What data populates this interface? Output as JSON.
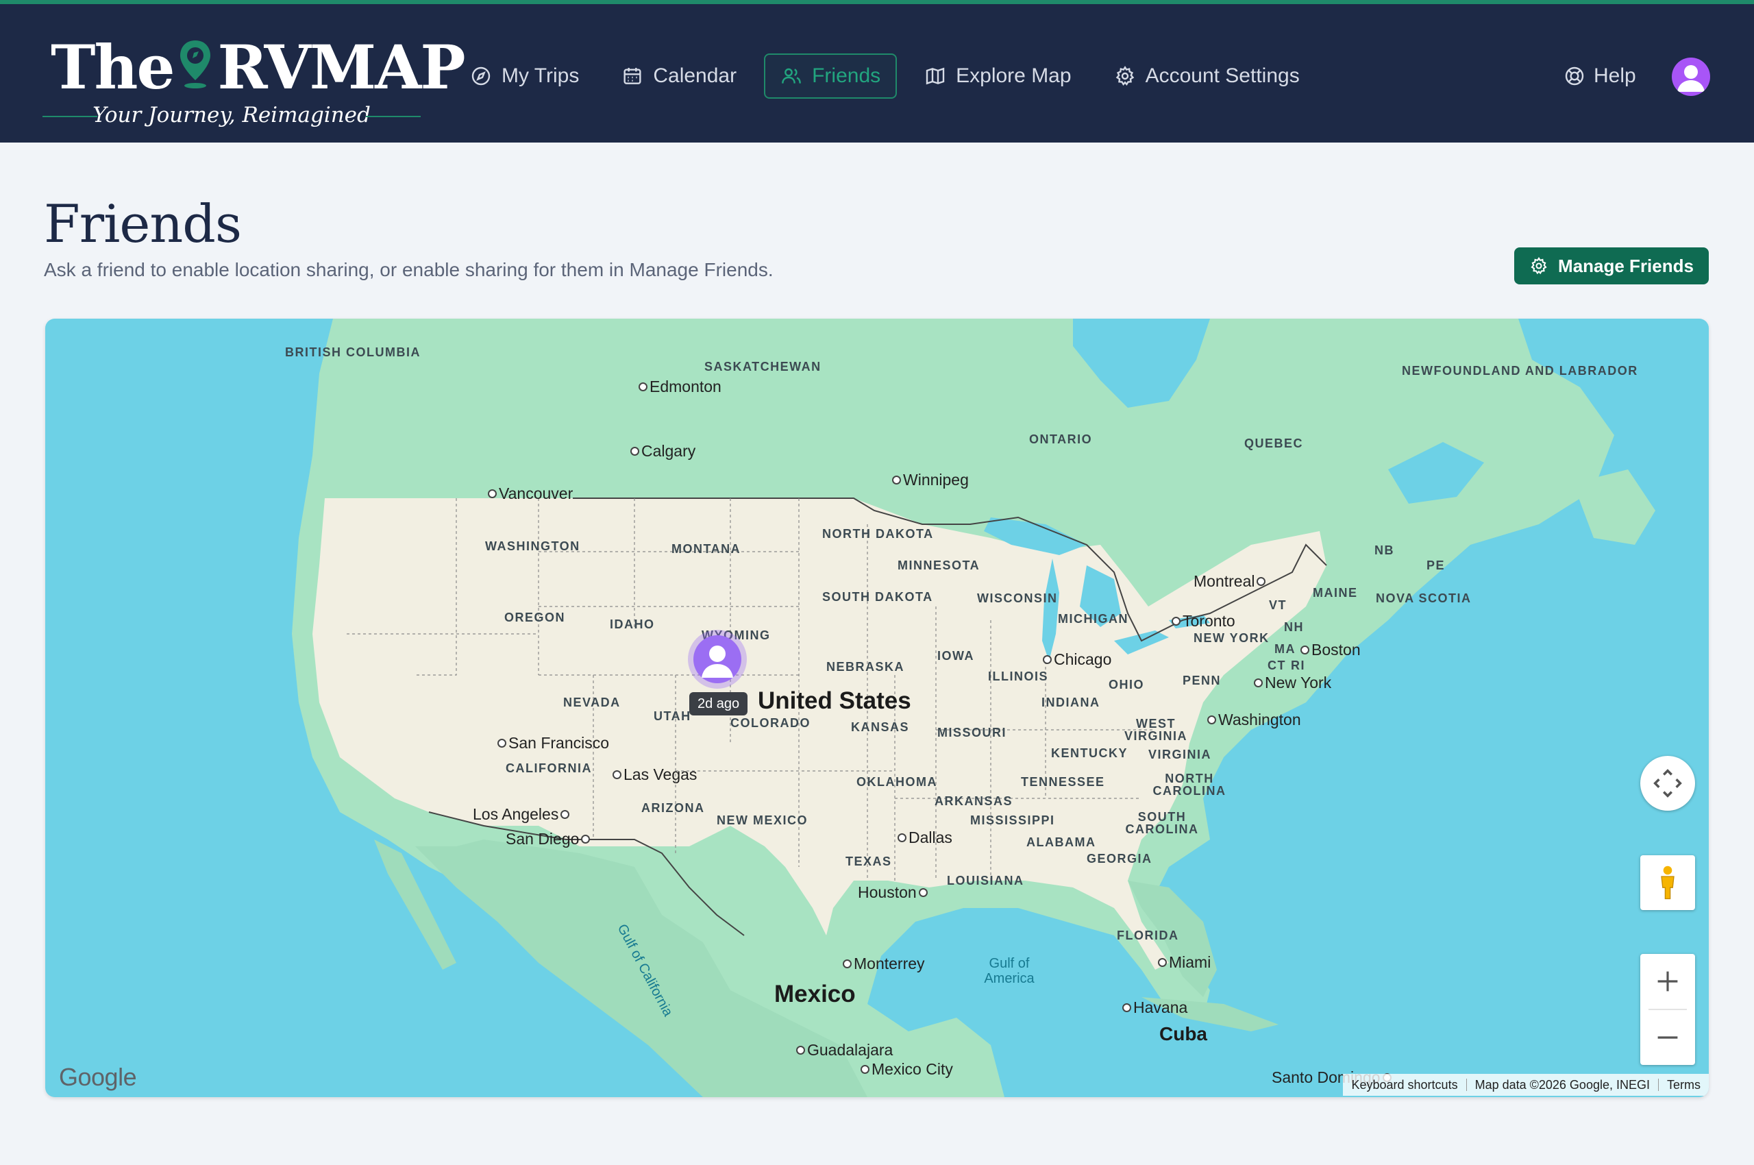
{
  "brand": {
    "title_left": "The",
    "title_right": "RVMAP",
    "tagline": "Your Journey, Reimagined"
  },
  "nav": {
    "items": [
      {
        "label": "My Trips",
        "icon": "compass-icon",
        "active": false
      },
      {
        "label": "Calendar",
        "icon": "calendar-icon",
        "active": false
      },
      {
        "label": "Friends",
        "icon": "users-icon",
        "active": true
      },
      {
        "label": "Explore Map",
        "icon": "map-icon",
        "active": false
      },
      {
        "label": "Account Settings",
        "icon": "gear-icon",
        "active": false
      }
    ],
    "help_label": "Help"
  },
  "colors": {
    "header_bg": "#1d2946",
    "accent": "#1f8a6a",
    "button_bg": "#0f6b52",
    "avatar": "#a855f7",
    "water": "#6dd1e6",
    "land": "#a8e3c2",
    "us_land": "#f2efe2"
  },
  "page": {
    "title": "Friends",
    "subtitle": "Ask a friend to enable location sharing, or enable sharing for them in Manage Friends.",
    "manage_button": "Manage Friends"
  },
  "map": {
    "friend_marker": {
      "last_seen": "2d ago"
    },
    "countries": [
      "United States",
      "Mexico",
      "Cuba"
    ],
    "regions": [
      "BRITISH COLUMBIA",
      "SASKATCHEWAN",
      "ONTARIO",
      "QUEBEC",
      "NEWFOUNDLAND AND LABRADOR",
      "NORTH DAKOTA",
      "SOUTH DAKOTA",
      "WASHINGTON",
      "MONTANA",
      "OREGON",
      "IDAHO",
      "WYOMING",
      "NEVADA",
      "UTAH",
      "COLORADO",
      "CALIFORNIA",
      "ARIZONA",
      "NEW MEXICO",
      "NEBRASKA",
      "KANSAS",
      "OKLAHOMA",
      "TEXAS",
      "MINNESOTA",
      "IOWA",
      "MISSOURI",
      "ARKANSAS",
      "LOUISIANA",
      "WISCONSIN",
      "ILLINOIS",
      "MICHIGAN",
      "INDIANA",
      "OHIO",
      "KENTUCKY",
      "TENNESSEE",
      "MISSISSIPPI",
      "ALABAMA",
      "GEORGIA",
      "FLORIDA",
      "SOUTH CAROLINA",
      "NORTH CAROLINA",
      "VIRGINIA",
      "WEST VIRGINIA",
      "PENN",
      "NEW YORK",
      "VT",
      "NH",
      "MAINE",
      "MA",
      "CT",
      "RI",
      "NB",
      "PE",
      "NOVA SCOTIA"
    ],
    "cities": [
      "Edmonton",
      "Calgary",
      "Vancouver",
      "Winnipeg",
      "Montreal",
      "Toronto",
      "Boston",
      "New York",
      "Washington",
      "Chicago",
      "San Francisco",
      "Las Vegas",
      "Los Angeles",
      "San Diego",
      "Dallas",
      "Houston",
      "Monterrey",
      "Miami",
      "Havana",
      "Guadalajara",
      "Mexico City",
      "Santo Domingo"
    ],
    "water": [
      "Gulf of California",
      "Gulf of America"
    ],
    "attribution": {
      "shortcuts": "Keyboard shortcuts",
      "data": "Map data ©2026 Google, INEGI",
      "terms": "Terms"
    },
    "provider_logo": "Google"
  }
}
